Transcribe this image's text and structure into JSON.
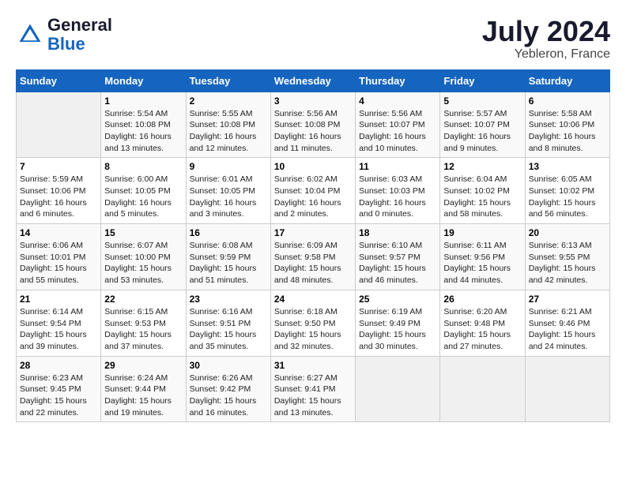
{
  "header": {
    "logo_line1": "General",
    "logo_line2": "Blue",
    "month_year": "July 2024",
    "location": "Yebleron, France"
  },
  "weekdays": [
    "Sunday",
    "Monday",
    "Tuesday",
    "Wednesday",
    "Thursday",
    "Friday",
    "Saturday"
  ],
  "weeks": [
    [
      {
        "day": "",
        "empty": true
      },
      {
        "day": "1",
        "sunrise": "Sunrise: 5:54 AM",
        "sunset": "Sunset: 10:08 PM",
        "daylight": "Daylight: 16 hours and 13 minutes."
      },
      {
        "day": "2",
        "sunrise": "Sunrise: 5:55 AM",
        "sunset": "Sunset: 10:08 PM",
        "daylight": "Daylight: 16 hours and 12 minutes."
      },
      {
        "day": "3",
        "sunrise": "Sunrise: 5:56 AM",
        "sunset": "Sunset: 10:08 PM",
        "daylight": "Daylight: 16 hours and 11 minutes."
      },
      {
        "day": "4",
        "sunrise": "Sunrise: 5:56 AM",
        "sunset": "Sunset: 10:07 PM",
        "daylight": "Daylight: 16 hours and 10 minutes."
      },
      {
        "day": "5",
        "sunrise": "Sunrise: 5:57 AM",
        "sunset": "Sunset: 10:07 PM",
        "daylight": "Daylight: 16 hours and 9 minutes."
      },
      {
        "day": "6",
        "sunrise": "Sunrise: 5:58 AM",
        "sunset": "Sunset: 10:06 PM",
        "daylight": "Daylight: 16 hours and 8 minutes."
      }
    ],
    [
      {
        "day": "7",
        "sunrise": "Sunrise: 5:59 AM",
        "sunset": "Sunset: 10:06 PM",
        "daylight": "Daylight: 16 hours and 6 minutes."
      },
      {
        "day": "8",
        "sunrise": "Sunrise: 6:00 AM",
        "sunset": "Sunset: 10:05 PM",
        "daylight": "Daylight: 16 hours and 5 minutes."
      },
      {
        "day": "9",
        "sunrise": "Sunrise: 6:01 AM",
        "sunset": "Sunset: 10:05 PM",
        "daylight": "Daylight: 16 hours and 3 minutes."
      },
      {
        "day": "10",
        "sunrise": "Sunrise: 6:02 AM",
        "sunset": "Sunset: 10:04 PM",
        "daylight": "Daylight: 16 hours and 2 minutes."
      },
      {
        "day": "11",
        "sunrise": "Sunrise: 6:03 AM",
        "sunset": "Sunset: 10:03 PM",
        "daylight": "Daylight: 16 hours and 0 minutes."
      },
      {
        "day": "12",
        "sunrise": "Sunrise: 6:04 AM",
        "sunset": "Sunset: 10:02 PM",
        "daylight": "Daylight: 15 hours and 58 minutes."
      },
      {
        "day": "13",
        "sunrise": "Sunrise: 6:05 AM",
        "sunset": "Sunset: 10:02 PM",
        "daylight": "Daylight: 15 hours and 56 minutes."
      }
    ],
    [
      {
        "day": "14",
        "sunrise": "Sunrise: 6:06 AM",
        "sunset": "Sunset: 10:01 PM",
        "daylight": "Daylight: 15 hours and 55 minutes."
      },
      {
        "day": "15",
        "sunrise": "Sunrise: 6:07 AM",
        "sunset": "Sunset: 10:00 PM",
        "daylight": "Daylight: 15 hours and 53 minutes."
      },
      {
        "day": "16",
        "sunrise": "Sunrise: 6:08 AM",
        "sunset": "Sunset: 9:59 PM",
        "daylight": "Daylight: 15 hours and 51 minutes."
      },
      {
        "day": "17",
        "sunrise": "Sunrise: 6:09 AM",
        "sunset": "Sunset: 9:58 PM",
        "daylight": "Daylight: 15 hours and 48 minutes."
      },
      {
        "day": "18",
        "sunrise": "Sunrise: 6:10 AM",
        "sunset": "Sunset: 9:57 PM",
        "daylight": "Daylight: 15 hours and 46 minutes."
      },
      {
        "day": "19",
        "sunrise": "Sunrise: 6:11 AM",
        "sunset": "Sunset: 9:56 PM",
        "daylight": "Daylight: 15 hours and 44 minutes."
      },
      {
        "day": "20",
        "sunrise": "Sunrise: 6:13 AM",
        "sunset": "Sunset: 9:55 PM",
        "daylight": "Daylight: 15 hours and 42 minutes."
      }
    ],
    [
      {
        "day": "21",
        "sunrise": "Sunrise: 6:14 AM",
        "sunset": "Sunset: 9:54 PM",
        "daylight": "Daylight: 15 hours and 39 minutes."
      },
      {
        "day": "22",
        "sunrise": "Sunrise: 6:15 AM",
        "sunset": "Sunset: 9:53 PM",
        "daylight": "Daylight: 15 hours and 37 minutes."
      },
      {
        "day": "23",
        "sunrise": "Sunrise: 6:16 AM",
        "sunset": "Sunset: 9:51 PM",
        "daylight": "Daylight: 15 hours and 35 minutes."
      },
      {
        "day": "24",
        "sunrise": "Sunrise: 6:18 AM",
        "sunset": "Sunset: 9:50 PM",
        "daylight": "Daylight: 15 hours and 32 minutes."
      },
      {
        "day": "25",
        "sunrise": "Sunrise: 6:19 AM",
        "sunset": "Sunset: 9:49 PM",
        "daylight": "Daylight: 15 hours and 30 minutes."
      },
      {
        "day": "26",
        "sunrise": "Sunrise: 6:20 AM",
        "sunset": "Sunset: 9:48 PM",
        "daylight": "Daylight: 15 hours and 27 minutes."
      },
      {
        "day": "27",
        "sunrise": "Sunrise: 6:21 AM",
        "sunset": "Sunset: 9:46 PM",
        "daylight": "Daylight: 15 hours and 24 minutes."
      }
    ],
    [
      {
        "day": "28",
        "sunrise": "Sunrise: 6:23 AM",
        "sunset": "Sunset: 9:45 PM",
        "daylight": "Daylight: 15 hours and 22 minutes."
      },
      {
        "day": "29",
        "sunrise": "Sunrise: 6:24 AM",
        "sunset": "Sunset: 9:44 PM",
        "daylight": "Daylight: 15 hours and 19 minutes."
      },
      {
        "day": "30",
        "sunrise": "Sunrise: 6:26 AM",
        "sunset": "Sunset: 9:42 PM",
        "daylight": "Daylight: 15 hours and 16 minutes."
      },
      {
        "day": "31",
        "sunrise": "Sunrise: 6:27 AM",
        "sunset": "Sunset: 9:41 PM",
        "daylight": "Daylight: 15 hours and 13 minutes."
      },
      {
        "day": "",
        "empty": true
      },
      {
        "day": "",
        "empty": true
      },
      {
        "day": "",
        "empty": true
      }
    ]
  ]
}
